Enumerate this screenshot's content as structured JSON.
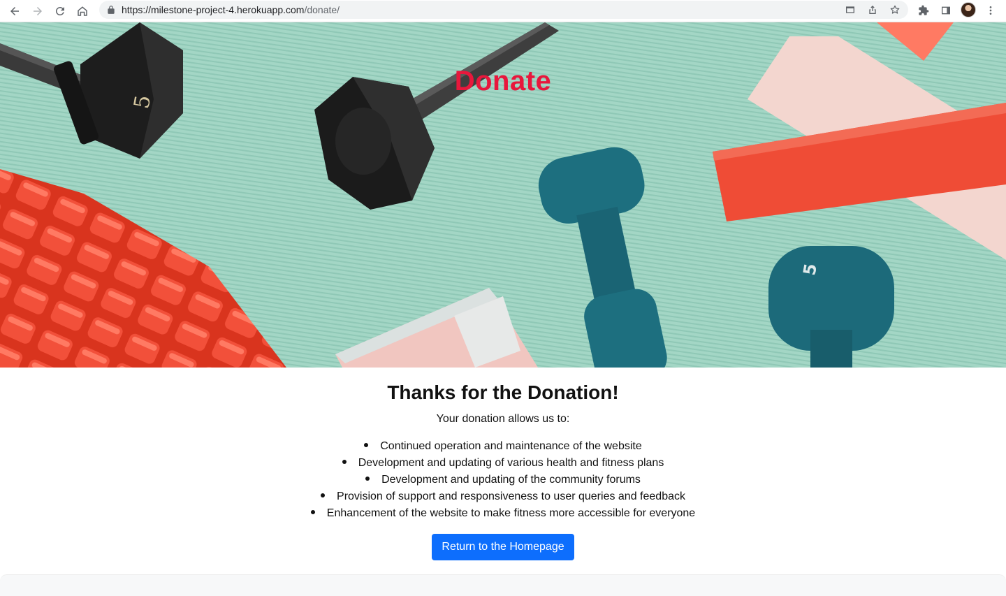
{
  "browser": {
    "url_host": "https://milestone-project-4.herokuapp.com",
    "url_path": "/donate/"
  },
  "hero": {
    "title": "Donate"
  },
  "main": {
    "heading": "Thanks for the Donation!",
    "intro": "Your donation allows us to:",
    "benefits": [
      "Continued operation and maintenance of the website",
      "Development and updating of various health and fitness plans",
      "Development and updating of the community forums",
      "Provision of support and responsiveness to user queries and feedback",
      "Enhancement of the website to make fitness more accessible for everyone"
    ],
    "button_label": "Return to the Homepage"
  },
  "colors": {
    "hero_title": "#e8173c",
    "button_bg": "#0d6efd",
    "mat": "#9fd3c2"
  }
}
